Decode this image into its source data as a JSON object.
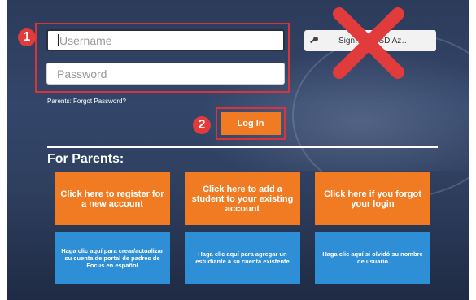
{
  "login": {
    "username_placeholder": "Username",
    "password_placeholder": "Password",
    "forgot_password": "Parents: Forgot Password?",
    "login_button": "Log In"
  },
  "azure_button": {
    "label": "Sign… …BSD Az…"
  },
  "steps": {
    "one": "1",
    "two": "2"
  },
  "parents": {
    "heading": "For Parents:",
    "tiles_orange": [
      "Click here to register for a new account",
      "Click here to add a student to your existing account",
      "Click here if you forgot your login"
    ],
    "tiles_blue": [
      "Haga clic aquí para crear/actualizar su cuenta de portal de padres de Focus en español",
      "Haga clic aquí para agregar un estudiante a su cuenta existente",
      "Haga clic aquí si olvidó su nombre de usuario"
    ]
  },
  "colors": {
    "accent_orange": "#f07b22",
    "tile_blue": "#2f8fd6",
    "annotation_red": "#e23b3b"
  },
  "icons": {
    "azure": "key-icon",
    "annotation": "x-mark-icon"
  }
}
